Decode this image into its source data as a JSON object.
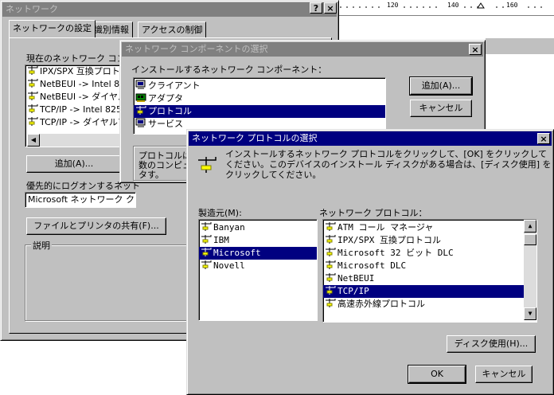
{
  "ruler": {
    "ticks": [
      "120",
      "140",
      "160"
    ]
  },
  "network_window": {
    "title": "ネットワーク",
    "help_button": "?",
    "close_button": "×",
    "tabs": [
      "ネットワークの設定",
      "識別情報",
      "アクセスの制御"
    ],
    "components_label": "現在のネットワーク コンポーネント",
    "components": [
      "IPX/SPX 互換プロトコル",
      "NetBEUI -> Intel 8255",
      "NetBEUI -> ダイヤルアップ",
      "TCP/IP -> Intel 8255",
      "TCP/IP -> ダイヤルアップ"
    ],
    "add_button": "追加(A)...",
    "logon_label": "優先的にログオンするネット",
    "logon_value": "Microsoft ネットワーク クライアント",
    "file_share_button": "ファイルとプリンタの共有(F)...",
    "description_label": "説明"
  },
  "component_dialog": {
    "title": "ネットワーク コンポーネントの選択",
    "close_button": "×",
    "prompt": "インストールするネットワーク コンポーネント：",
    "items": [
      "クライアント",
      "アダプタ",
      "プロトコル",
      "サービス"
    ],
    "selected_index": 2,
    "add_button": "追加(A)...",
    "cancel_button": "キャンセル",
    "description": "プロトコルは、数のコンピュータす。"
  },
  "protocol_dialog": {
    "title": "ネットワーク プロトコルの選択",
    "close_button": "×",
    "instruction": "インストールするネットワーク プロトコルをクリックして、[OK] をクリックしてください。このデバイスのインストール ディスクがある場合は、[ディスク使用] をクリックしてください。",
    "manufacturers_label": "製造元(M):",
    "manufacturers": [
      "Banyan",
      "IBM",
      "Microsoft",
      "Novell"
    ],
    "manufacturer_selected": 2,
    "protocols_label": "ネットワーク プロトコル：",
    "protocols": [
      "ATM コール マネージャ",
      "IPX/SPX 互換プロトコル",
      "Microsoft 32 ビット DLC",
      "Microsoft DLC",
      "NetBEUI",
      "TCP/IP",
      "高速赤外線プロトコル"
    ],
    "protocol_selected": 5,
    "disk_button": "ディスク使用(H)...",
    "ok_button": "OK",
    "cancel_button": "キャンセル"
  }
}
